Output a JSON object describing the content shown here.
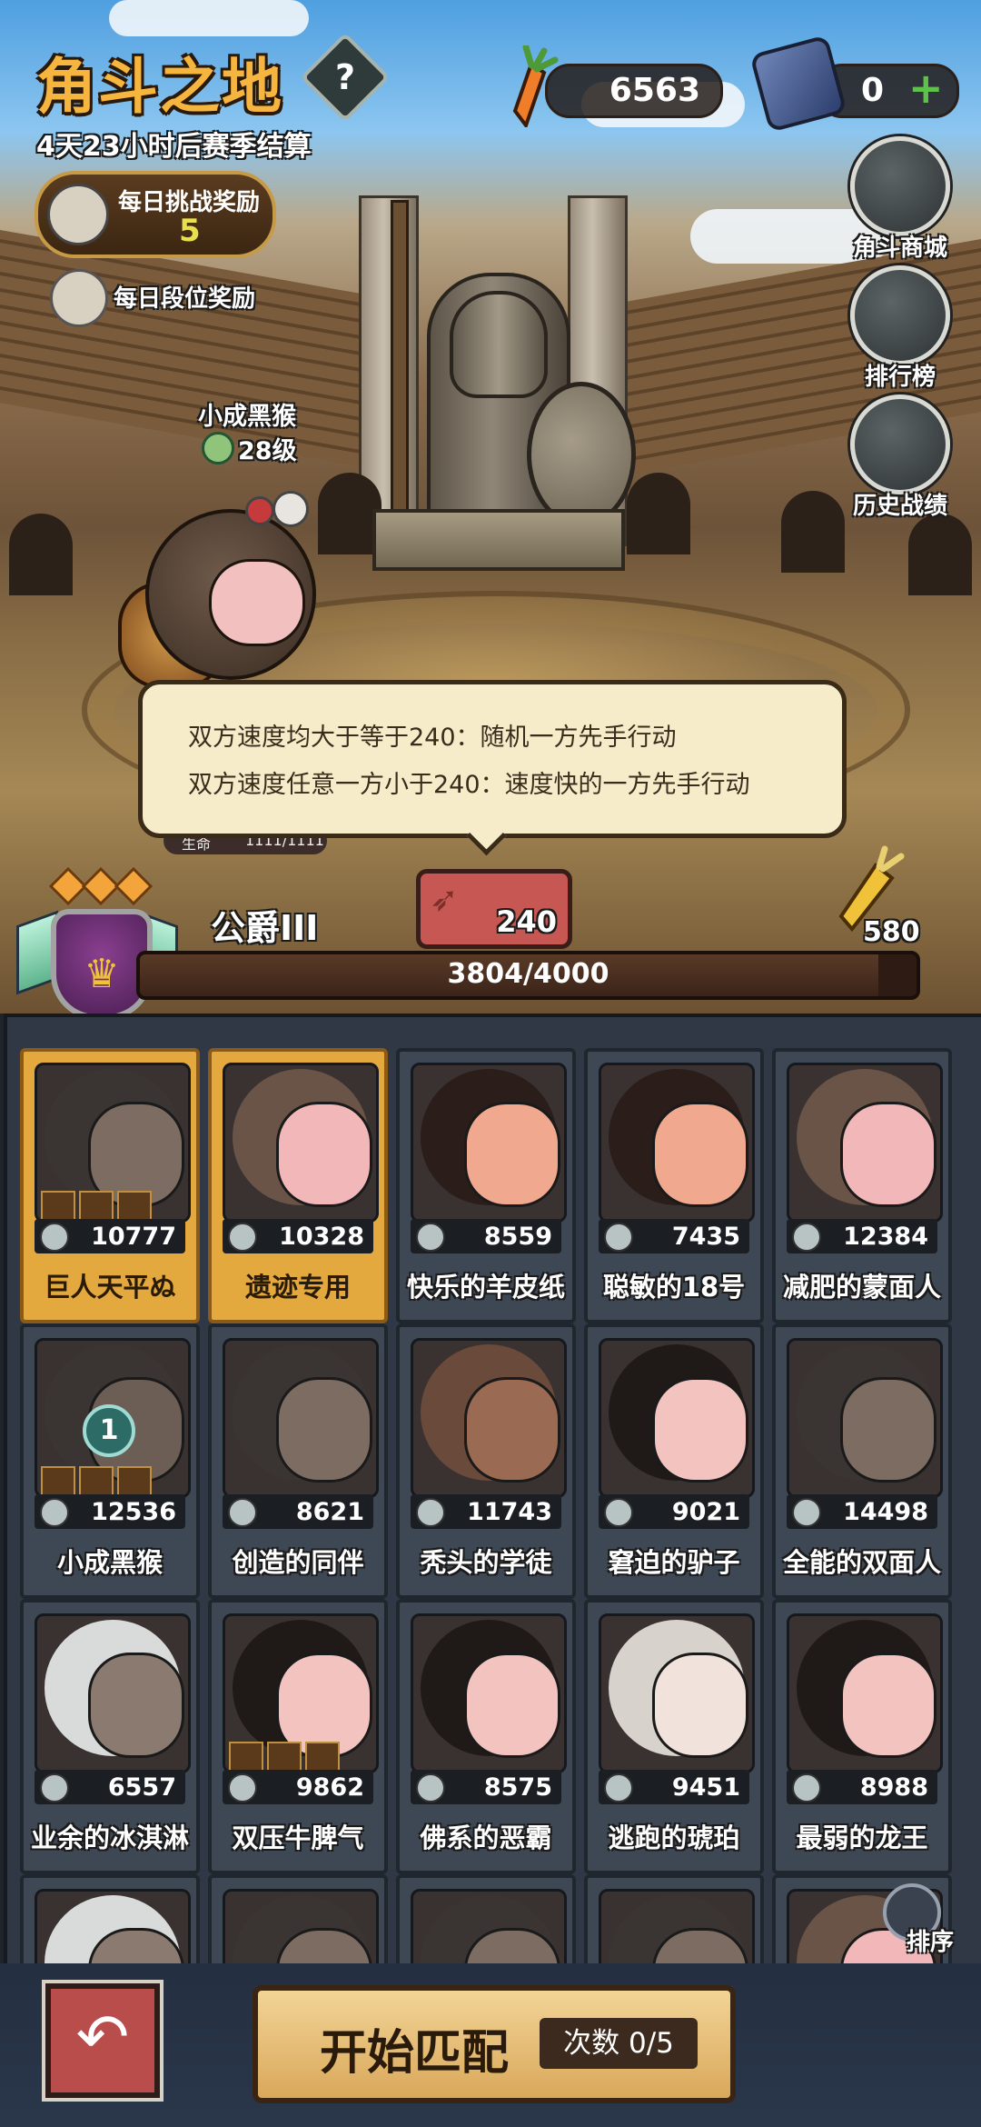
{
  "header": {
    "title": "角斗之地",
    "help_label": "?",
    "season_text": "4天23小时后赛季结算"
  },
  "resources": {
    "carrots": "6563",
    "gems": "0",
    "add_label": "+"
  },
  "rewards": {
    "daily_challenge_label": "每日挑战奖励",
    "daily_challenge_count": "5",
    "daily_rank_label": "每日段位奖励"
  },
  "side_menu": [
    {
      "label": "角斗商城",
      "icon": "money-bag-icon"
    },
    {
      "label": "排行榜",
      "icon": "trophy-icon"
    },
    {
      "label": "历史战绩",
      "icon": "scroll-icon"
    }
  ],
  "character": {
    "name": "小成黑猴",
    "level": "28级",
    "hp_label": "生命",
    "hp_value": "1111/1111"
  },
  "tooltip": {
    "line1": "双方速度均大于等于240：随机一方先手行动",
    "line2": "双方速度任意一方小于240：速度快的一方先手行动"
  },
  "speed": {
    "value": "240"
  },
  "rank": {
    "name": "公爵III",
    "progress_text": "3804/4000",
    "progress_value": 3804,
    "progress_max": 4000,
    "stars": 3
  },
  "golden_carrot": {
    "value": "580"
  },
  "cards": [
    {
      "name": "巨人天平ぬ",
      "power": "10777",
      "selected": true,
      "equip": 4,
      "hair": "#3a3533",
      "face": "#7d6c62"
    },
    {
      "name": "遗迹专用",
      "power": "10328",
      "selected": true,
      "hair": "#6a5448",
      "face": "#f2b7b8"
    },
    {
      "name": "快乐的羊皮纸",
      "power": "8559",
      "selected": false,
      "hair": "#2a1d1a",
      "face": "#f0a98e"
    },
    {
      "name": "聪敏的18号",
      "power": "7435",
      "selected": false,
      "hair": "#2a1d1a",
      "face": "#f0a98e"
    },
    {
      "name": "减肥的蒙面人",
      "power": "12384",
      "selected": false,
      "hair": "#6a5448",
      "face": "#f2b7b8"
    },
    {
      "name": "小成黑猴",
      "power": "12536",
      "selected": false,
      "equip": 4,
      "badge": "1",
      "hair": "#3a3533",
      "face": "#6d5e55"
    },
    {
      "name": "创造的同伴",
      "power": "8621",
      "selected": false,
      "hair": "#3a3533",
      "face": "#7d6c62"
    },
    {
      "name": "秃头的学徒",
      "power": "11743",
      "selected": false,
      "hair": "#6a4a3a",
      "face": "#9a6a52"
    },
    {
      "name": "窘迫的驴子",
      "power": "9021",
      "selected": false,
      "hair": "#1f1a18",
      "face": "#f3c3c0"
    },
    {
      "name": "全能的双面人",
      "power": "14498",
      "selected": false,
      "hair": "#3a3533",
      "face": "#7d6c62"
    },
    {
      "name": "业余的冰淇淋",
      "power": "6557",
      "selected": false,
      "hair": "#d8dbd9",
      "face": "#8a7a70"
    },
    {
      "name": "双压牛脾气",
      "power": "9862",
      "selected": false,
      "equip": 4,
      "hair": "#1f1a18",
      "face": "#f3c3c0"
    },
    {
      "name": "佛系的恶霸",
      "power": "8575",
      "selected": false,
      "hair": "#1f1a18",
      "face": "#f3c3c0"
    },
    {
      "name": "逃跑的琥珀",
      "power": "9451",
      "selected": false,
      "hair": "#d8d2cc",
      "face": "#f1e3dc"
    },
    {
      "name": "最弱的龙王",
      "power": "8988",
      "selected": false,
      "hair": "#1f1a18",
      "face": "#f3c3c0"
    },
    {
      "name": "",
      "power": "",
      "selected": false,
      "partial": true,
      "hair": "#d8dbd9",
      "face": "#8a7a70"
    },
    {
      "name": "",
      "power": "",
      "selected": false,
      "partial": true,
      "hair": "#3a3533",
      "face": "#7d6c62"
    },
    {
      "name": "",
      "power": "",
      "selected": false,
      "partial": true,
      "hair": "#3a3533",
      "face": "#7d6c62"
    },
    {
      "name": "",
      "power": "",
      "selected": false,
      "partial": true,
      "hair": "#3a3533",
      "face": "#7d6c62"
    },
    {
      "name": "",
      "power": "",
      "selected": false,
      "partial": true,
      "hair": "#6a5448",
      "face": "#f2b7b8"
    }
  ],
  "sort": {
    "label": "排序"
  },
  "bottom": {
    "back_icon": "back-arrow-icon",
    "match_label": "开始匹配",
    "match_count": "次数 0/5"
  }
}
